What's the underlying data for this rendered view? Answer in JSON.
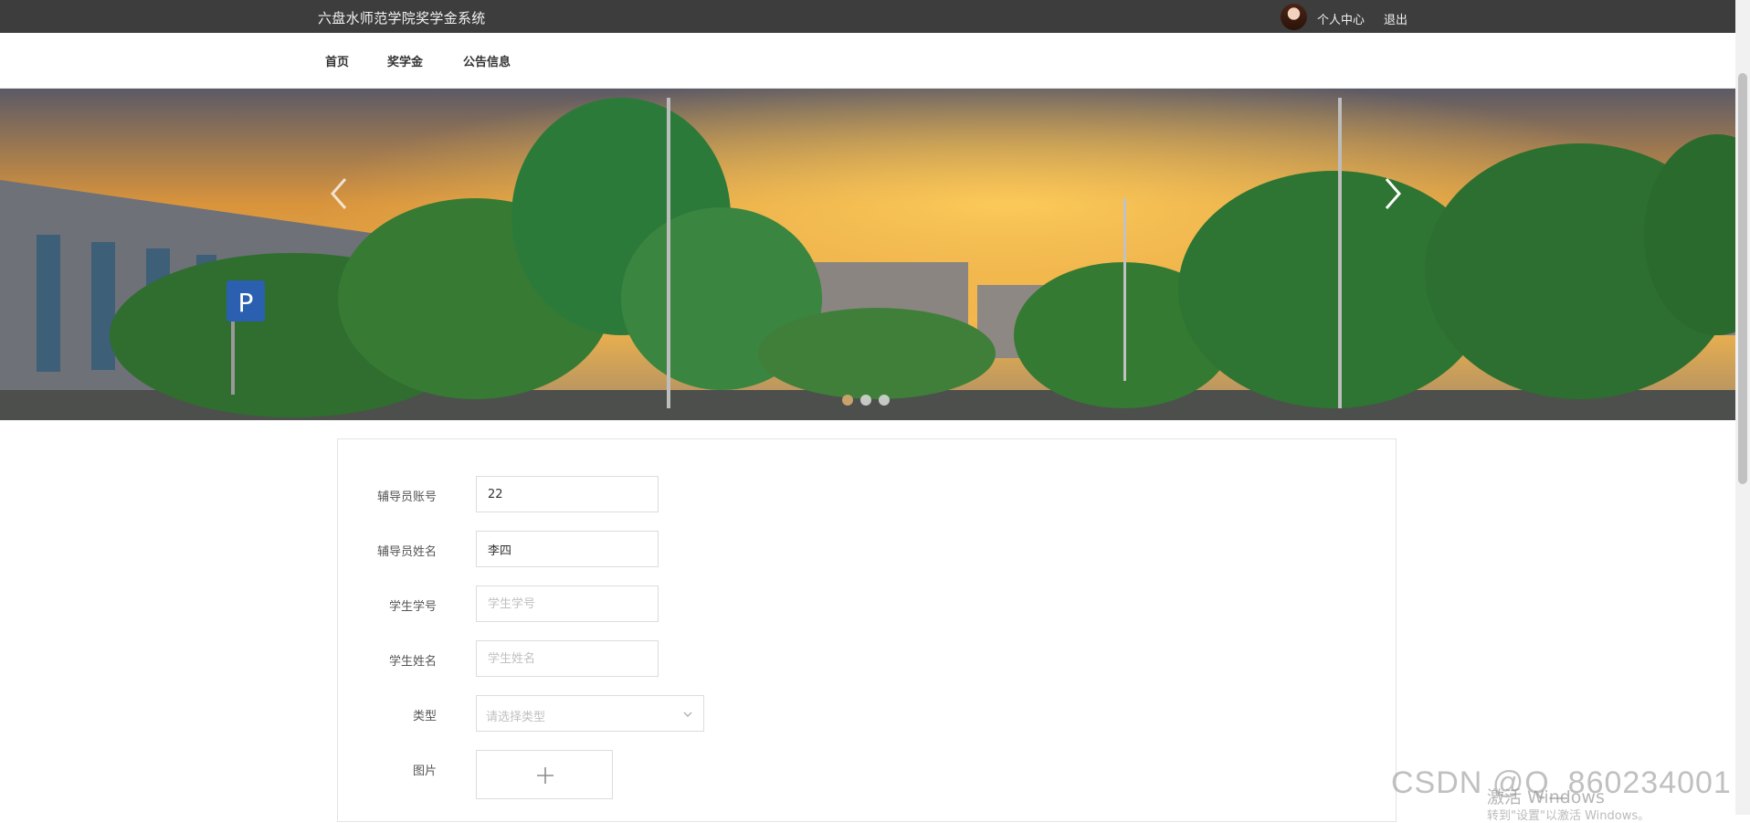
{
  "header": {
    "site_title": "六盘水师范学院奖学金系统",
    "profile_label": "个人中心",
    "logout_label": "退出"
  },
  "nav": {
    "items": [
      {
        "label": "首页"
      },
      {
        "label": "奖学金"
      },
      {
        "label": "公告信息"
      }
    ]
  },
  "carousel": {
    "slide_count": 3,
    "active_index": 0,
    "prev_icon": "chevron-left-icon",
    "next_icon": "chevron-right-icon"
  },
  "form": {
    "counselor_account": {
      "label": "辅导员账号",
      "value": "22",
      "placeholder": "辅导员账号"
    },
    "counselor_name": {
      "label": "辅导员姓名",
      "value": "李四",
      "placeholder": "辅导员姓名"
    },
    "student_id": {
      "label": "学生学号",
      "value": "",
      "placeholder": "学生学号"
    },
    "student_name": {
      "label": "学生姓名",
      "value": "",
      "placeholder": "学生姓名"
    },
    "type": {
      "label": "类型",
      "placeholder": "请选择类型"
    },
    "image": {
      "label": "图片",
      "upload_icon": "plus-icon"
    }
  },
  "watermarks": {
    "csdn": "CSDN @Q_860234001",
    "windows_line1": "激活 Windows",
    "windows_line2": "转到\"设置\"以激活 Windows。"
  },
  "colors": {
    "topbar_bg": "#3d3d3d",
    "active_dot": "#c8a26a"
  }
}
